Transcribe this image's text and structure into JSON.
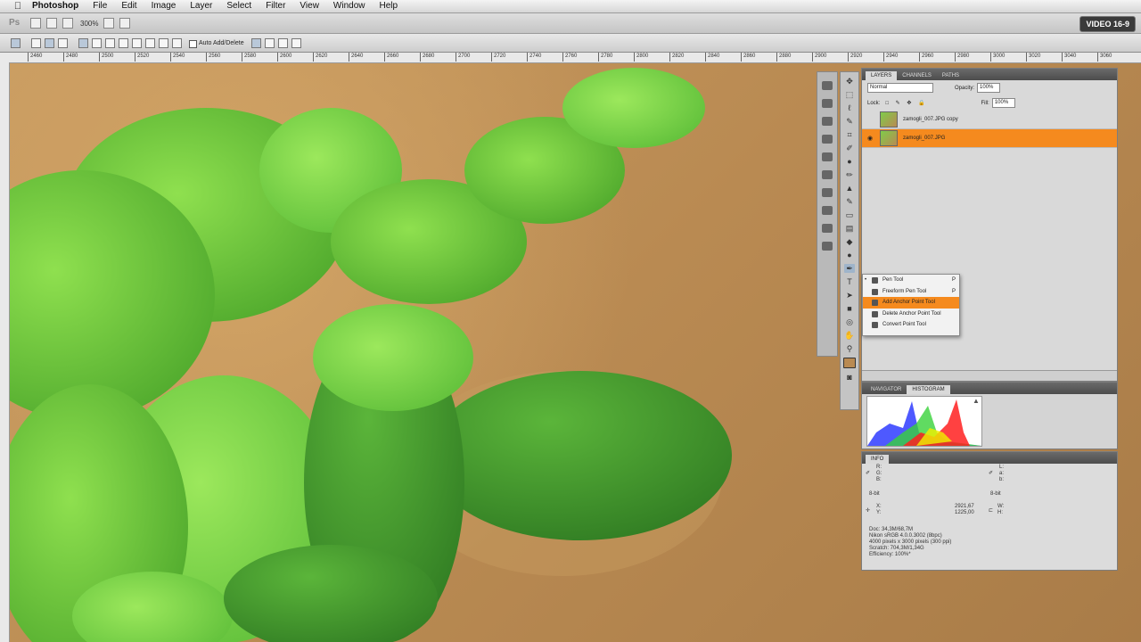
{
  "menubar": {
    "app_name": "Photoshop",
    "items": [
      "File",
      "Edit",
      "Image",
      "Layer",
      "Select",
      "Filter",
      "View",
      "Window",
      "Help"
    ]
  },
  "badge": "VIDEO 16-9",
  "appbar": {
    "logo": "Ps",
    "zoom": "300%"
  },
  "options": {
    "auto_add_delete": "Auto Add/Delete"
  },
  "ruler": {
    "ticks": [
      "2460",
      "2480",
      "2500",
      "2520",
      "2540",
      "2560",
      "2580",
      "2600",
      "2620",
      "2640",
      "2660",
      "2680",
      "2700",
      "2720",
      "2740",
      "2760",
      "2780",
      "2800",
      "2820",
      "2840",
      "2860",
      "2880",
      "2900",
      "2920",
      "2940",
      "2960",
      "2980",
      "3000",
      "3020",
      "3040",
      "3060"
    ]
  },
  "layers_panel": {
    "tabs": [
      "LAYERS",
      "CHANNELS",
      "PATHS"
    ],
    "blend_mode": "Normal",
    "opacity_label": "Opacity:",
    "opacity_value": "100%",
    "lock_label": "Lock:",
    "fill_label": "Fill:",
    "fill_value": "100%",
    "layers": [
      {
        "name": "zamogli_007.JPG copy",
        "selected": false
      },
      {
        "name": "zamogli_007.JPG",
        "selected": true
      }
    ]
  },
  "nav_panel": {
    "tabs": [
      "NAVIGATOR",
      "HISTOGRAM"
    ]
  },
  "info_panel": {
    "title": "INFO",
    "rgb_labels": [
      "R:",
      "G:",
      "B:"
    ],
    "lab_labels": [
      "L:",
      "a:",
      "b:"
    ],
    "bit_left": "8-bit",
    "bit_right": "8-bit",
    "x_label": "X:",
    "y_label": "Y:",
    "x_value": "2921,67",
    "y_value": "1225,00",
    "w_label": "W:",
    "h_label": "H:",
    "doc_lines": [
      "Doc: 34,3M/68,7M",
      "Nikon sRGB 4.0.0.3002 (8bpc)",
      "4000 pixels x 3000 pixels (300 ppi)",
      "Scratch: 704,3M/1,34G",
      "Efficiency: 100%*"
    ]
  },
  "pen_flyout": {
    "items": [
      {
        "label": "Pen Tool",
        "key": "P",
        "current": true,
        "highlight": false
      },
      {
        "label": "Freeform Pen Tool",
        "key": "P",
        "current": false,
        "highlight": false
      },
      {
        "label": "Add Anchor Point Tool",
        "key": "",
        "current": false,
        "highlight": true
      },
      {
        "label": "Delete Anchor Point Tool",
        "key": "",
        "current": false,
        "highlight": false
      },
      {
        "label": "Convert Point Tool",
        "key": "",
        "current": false,
        "highlight": false
      }
    ]
  }
}
